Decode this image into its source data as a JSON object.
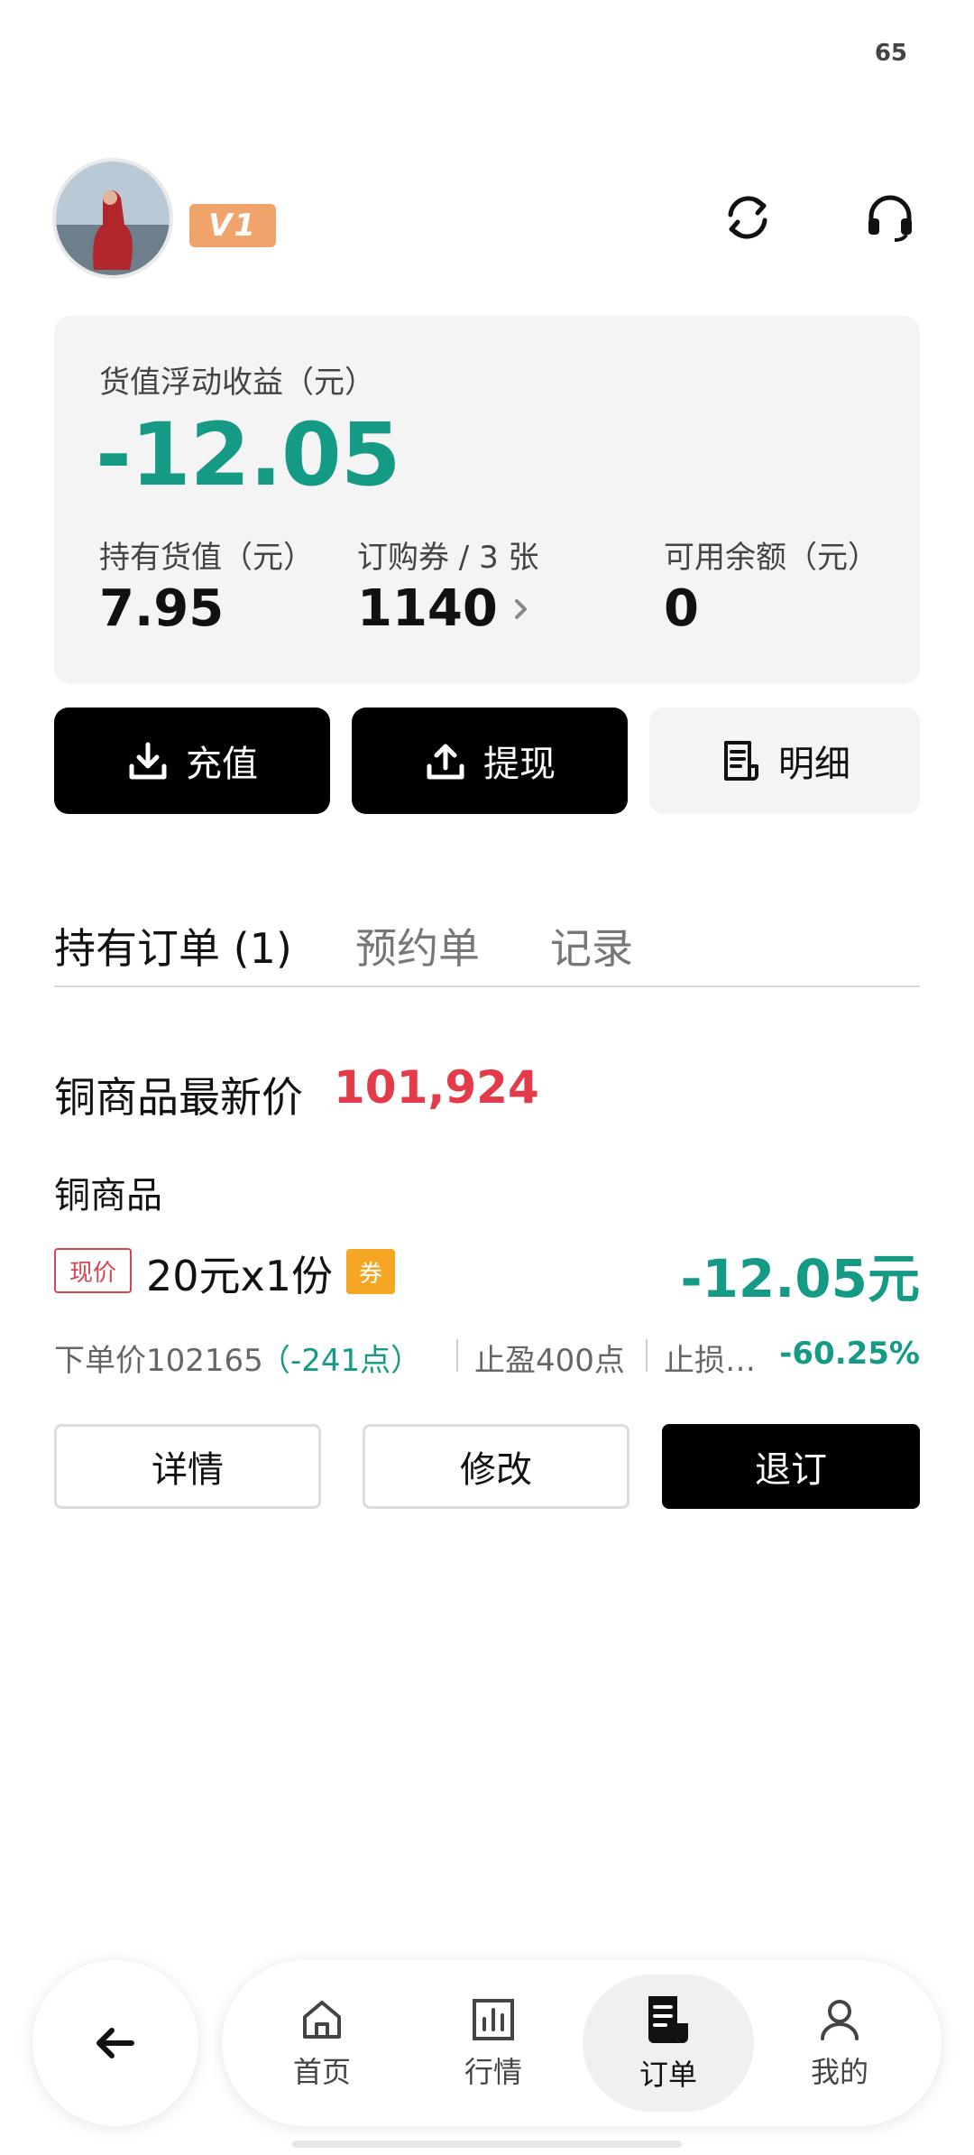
{
  "status_bar": {
    "battery": "65"
  },
  "header": {
    "vip_badge": "V1"
  },
  "summary": {
    "float_label": "货值浮动收益（元）",
    "float_value": "-12.05",
    "hold_label": "持有货值（元）",
    "hold_value": "7.95",
    "coupon_label": "订购券 / 3 张",
    "coupon_value": "1140",
    "balance_label": "可用余额（元）",
    "balance_value": "0"
  },
  "actions": {
    "recharge": "充值",
    "withdraw": "提现",
    "detail": "明细"
  },
  "tabs": [
    {
      "label": "持有订单 (1)"
    },
    {
      "label": "预约单"
    },
    {
      "label": "记录"
    }
  ],
  "order": {
    "latest_price_label": "铜商品最新价",
    "latest_price": "101,924",
    "product_name": "铜商品",
    "tag_now": "现价",
    "spec": "20元x1份",
    "coupon_tag": "券",
    "pnl": "-12.05元",
    "entry_price": "下单价102165",
    "points": "（-241点）",
    "take_profit": "止盈400点",
    "stop_loss": "止损…",
    "percent": "-60.25%",
    "btn_detail": "详情",
    "btn_modify": "修改",
    "btn_cancel": "退订"
  },
  "nav": [
    {
      "label": "首页",
      "icon": "home-icon"
    },
    {
      "label": "行情",
      "icon": "chart-icon"
    },
    {
      "label": "订单",
      "icon": "order-icon"
    },
    {
      "label": "我的",
      "icon": "user-icon"
    }
  ],
  "colors": {
    "green": "#159a85",
    "red": "#e33b4a",
    "vip": "#f0a36b",
    "coupon": "#f5a623"
  }
}
